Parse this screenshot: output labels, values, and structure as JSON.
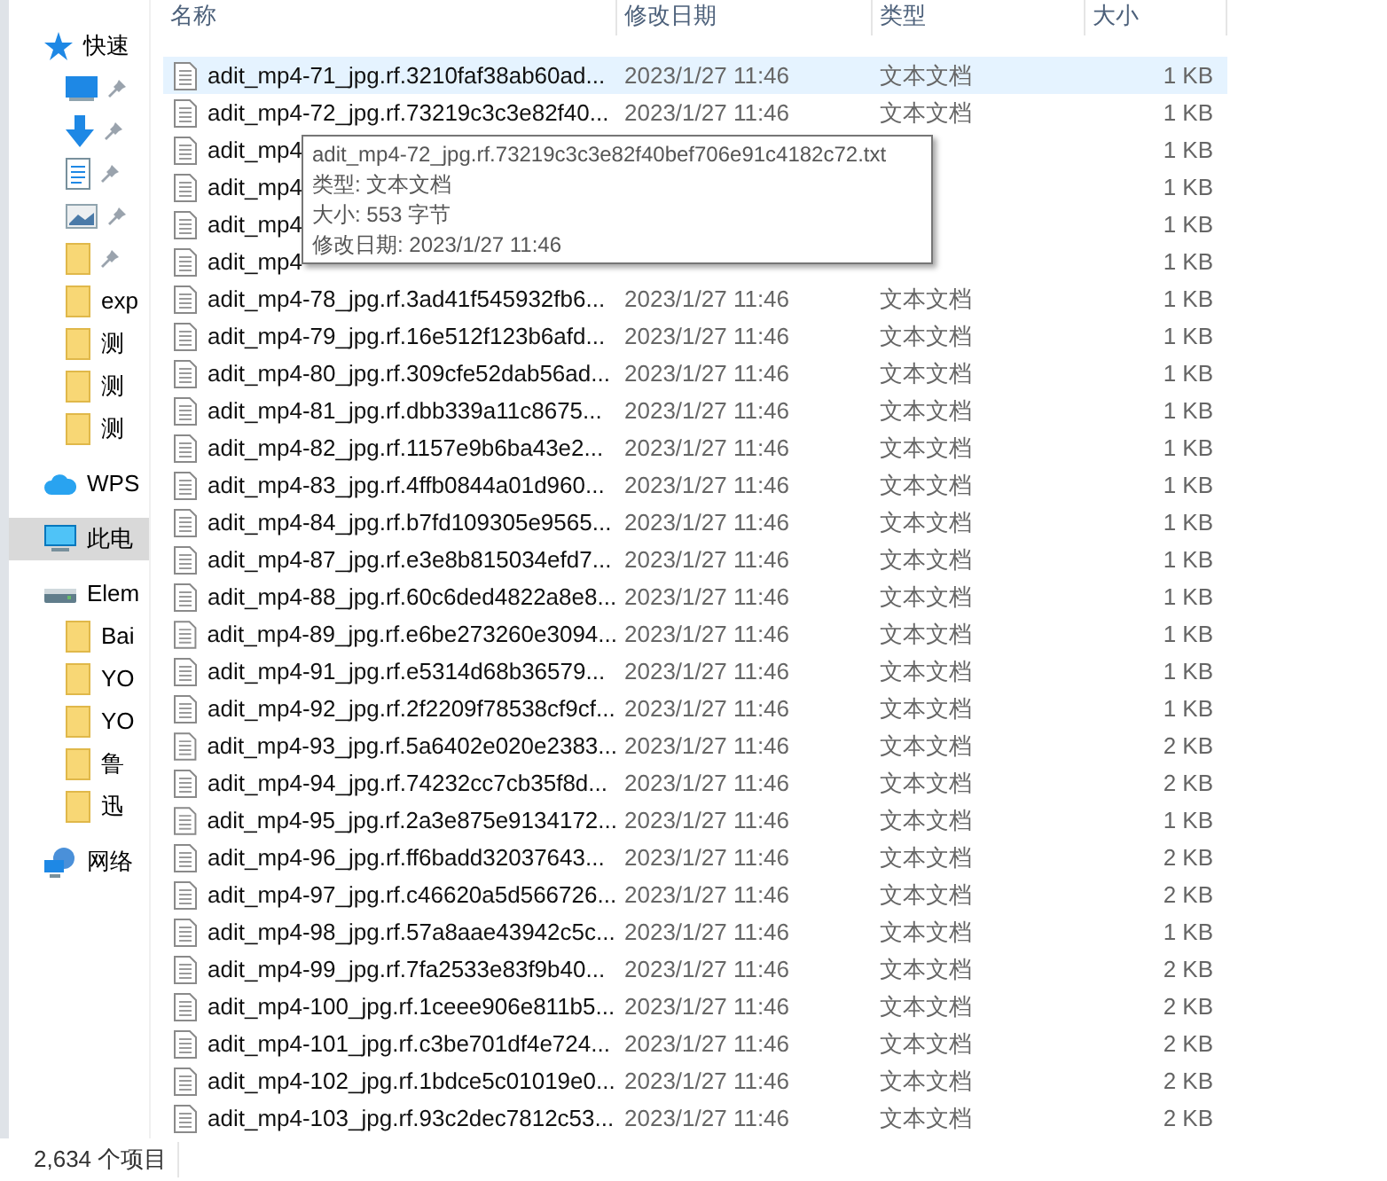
{
  "sidebar": {
    "items": [
      {
        "label": "快速",
        "kind": "star",
        "selected": false,
        "children": [
          {
            "kind": "pinned"
          },
          {
            "kind": "pinned"
          },
          {
            "kind": "pinned"
          },
          {
            "kind": "pinned"
          },
          {
            "kind": "pinned"
          },
          {
            "label": "exp",
            "kind": "folder"
          },
          {
            "label": "测",
            "kind": "folder"
          },
          {
            "label": "测",
            "kind": "folder"
          },
          {
            "label": "测",
            "kind": "folder"
          }
        ]
      },
      {
        "label": "WPS",
        "kind": "cloud",
        "selected": false
      },
      {
        "label": "此电",
        "kind": "pc",
        "selected": true
      },
      {
        "label": "Elem",
        "kind": "drive",
        "selected": false,
        "children": [
          {
            "label": "Bai",
            "kind": "folder"
          },
          {
            "label": "YO",
            "kind": "folder"
          },
          {
            "label": "YO",
            "kind": "folder"
          },
          {
            "label": "鲁",
            "kind": "folder"
          },
          {
            "label": "迅",
            "kind": "folder"
          }
        ]
      },
      {
        "label": "网络",
        "kind": "network",
        "selected": false
      }
    ]
  },
  "table": {
    "columns": [
      "名称",
      "修改日期",
      "类型",
      "大小"
    ],
    "rows": [
      {
        "name": "adit_mp4-71_jpg.rf.3210faf38ab60ad...",
        "date": "2023/1/27 11:46",
        "type": "文本文档",
        "size": "1 KB",
        "selected": true
      },
      {
        "name": "adit_mp4-72_jpg.rf.73219c3c3e82f40...",
        "date": "2023/1/27 11:46",
        "type": "文本文档",
        "size": "1 KB",
        "selected": false
      },
      {
        "name": "adit_mp4",
        "size": "1 KB",
        "selected": false
      },
      {
        "name": "adit_mp4",
        "size": "1 KB",
        "selected": false
      },
      {
        "name": "adit_mp4",
        "size": "1 KB",
        "selected": false
      },
      {
        "name": "adit_mp4",
        "size": "1 KB",
        "selected": false
      },
      {
        "name": "adit_mp4-78_jpg.rf.3ad41f545932fb6...",
        "date": "2023/1/27 11:46",
        "type": "文本文档",
        "size": "1 KB",
        "selected": false
      },
      {
        "name": "adit_mp4-79_jpg.rf.16e512f123b6afd...",
        "date": "2023/1/27 11:46",
        "type": "文本文档",
        "size": "1 KB",
        "selected": false
      },
      {
        "name": "adit_mp4-80_jpg.rf.309cfe52dab56ad...",
        "date": "2023/1/27 11:46",
        "type": "文本文档",
        "size": "1 KB",
        "selected": false
      },
      {
        "name": "adit_mp4-81_jpg.rf.dbb339a11c8675...",
        "date": "2023/1/27 11:46",
        "type": "文本文档",
        "size": "1 KB",
        "selected": false
      },
      {
        "name": "adit_mp4-82_jpg.rf.1157e9b6ba43e2...",
        "date": "2023/1/27 11:46",
        "type": "文本文档",
        "size": "1 KB",
        "selected": false
      },
      {
        "name": "adit_mp4-83_jpg.rf.4ffb0844a01d960...",
        "date": "2023/1/27 11:46",
        "type": "文本文档",
        "size": "1 KB",
        "selected": false
      },
      {
        "name": "adit_mp4-84_jpg.rf.b7fd109305e9565...",
        "date": "2023/1/27 11:46",
        "type": "文本文档",
        "size": "1 KB",
        "selected": false
      },
      {
        "name": "adit_mp4-87_jpg.rf.e3e8b815034efd7...",
        "date": "2023/1/27 11:46",
        "type": "文本文档",
        "size": "1 KB",
        "selected": false
      },
      {
        "name": "adit_mp4-88_jpg.rf.60c6ded4822a8e8...",
        "date": "2023/1/27 11:46",
        "type": "文本文档",
        "size": "1 KB",
        "selected": false
      },
      {
        "name": "adit_mp4-89_jpg.rf.e6be273260e3094...",
        "date": "2023/1/27 11:46",
        "type": "文本文档",
        "size": "1 KB",
        "selected": false
      },
      {
        "name": "adit_mp4-91_jpg.rf.e5314d68b36579...",
        "date": "2023/1/27 11:46",
        "type": "文本文档",
        "size": "1 KB",
        "selected": false
      },
      {
        "name": "adit_mp4-92_jpg.rf.2f2209f78538cf9cf...",
        "date": "2023/1/27 11:46",
        "type": "文本文档",
        "size": "1 KB",
        "selected": false
      },
      {
        "name": "adit_mp4-93_jpg.rf.5a6402e020e2383...",
        "date": "2023/1/27 11:46",
        "type": "文本文档",
        "size": "2 KB",
        "selected": false
      },
      {
        "name": "adit_mp4-94_jpg.rf.74232cc7cb35f8d...",
        "date": "2023/1/27 11:46",
        "type": "文本文档",
        "size": "2 KB",
        "selected": false
      },
      {
        "name": "adit_mp4-95_jpg.rf.2a3e875e9134172...",
        "date": "2023/1/27 11:46",
        "type": "文本文档",
        "size": "1 KB",
        "selected": false
      },
      {
        "name": "adit_mp4-96_jpg.rf.ff6badd32037643...",
        "date": "2023/1/27 11:46",
        "type": "文本文档",
        "size": "2 KB",
        "selected": false
      },
      {
        "name": "adit_mp4-97_jpg.rf.c46620a5d566726...",
        "date": "2023/1/27 11:46",
        "type": "文本文档",
        "size": "2 KB",
        "selected": false
      },
      {
        "name": "adit_mp4-98_jpg.rf.57a8aae43942c5c...",
        "date": "2023/1/27 11:46",
        "type": "文本文档",
        "size": "1 KB",
        "selected": false
      },
      {
        "name": "adit_mp4-99_jpg.rf.7fa2533e83f9b40...",
        "date": "2023/1/27 11:46",
        "type": "文本文档",
        "size": "2 KB",
        "selected": false
      },
      {
        "name": "adit_mp4-100_jpg.rf.1ceee906e811b5...",
        "date": "2023/1/27 11:46",
        "type": "文本文档",
        "size": "2 KB",
        "selected": false
      },
      {
        "name": "adit_mp4-101_jpg.rf.c3be701df4e724...",
        "date": "2023/1/27 11:46",
        "type": "文本文档",
        "size": "2 KB",
        "selected": false
      },
      {
        "name": "adit_mp4-102_jpg.rf.1bdce5c01019e0...",
        "date": "2023/1/27 11:46",
        "type": "文本文档",
        "size": "2 KB",
        "selected": false
      },
      {
        "name": "adit_mp4-103_jpg.rf.93c2dec7812c53...",
        "date": "2023/1/27 11:46",
        "type": "文本文档",
        "size": "2 KB",
        "selected": false
      }
    ]
  },
  "tooltip": {
    "lines": [
      "adit_mp4-72_jpg.rf.73219c3c3e82f40bef706e91c4182c72.txt",
      "类型: 文本文档",
      "大小: 553 字节",
      "修改日期: 2023/1/27 11:46"
    ]
  },
  "status_bar": {
    "count": "2,634 个项目"
  }
}
